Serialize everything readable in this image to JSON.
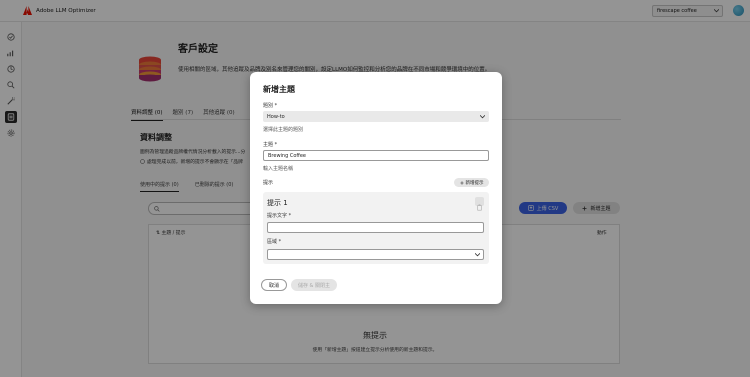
{
  "app": {
    "title": "Adobe LLM Optimizer",
    "brand_color": "#eb1000"
  },
  "org_selector": {
    "value": "firescape coffee"
  },
  "sidebar": {
    "icons": [
      "home-icon",
      "chart-icon",
      "compass-icon",
      "search-icon",
      "wand-icon",
      "settings-page-icon",
      "gear-icon"
    ],
    "active_index": 5
  },
  "page": {
    "title": "客戶設定",
    "description": "使用相關的區域，其他追蹤及品牌及別名來管理您的關別，設定LLMO如何監控和分析您的品牌在不同市場和競爭環境中的位置。"
  },
  "tabs": [
    "資料調整 (0)",
    "題別 (7)",
    "其他追蹤 (0)"
  ],
  "section": {
    "title": "資料調整",
    "description": "圖例為管理追蹤品牌權代情況分析載入的提示...分",
    "note": "處理完成以前，新增的提示不會顯示在「品牌"
  },
  "subtabs": [
    "使用中的提示 (0)",
    "已刪除的提示 (0)"
  ],
  "toolbar": {
    "upload_label": "上傳 CSV",
    "add_topic_label": "新增主題",
    "accent": "#3b63e6"
  },
  "table": {
    "col_topic": "主題 / 提示",
    "col_actions": "動作"
  },
  "empty": {
    "title": "無提示",
    "description": "使用「新增主題」按鈕建立提示分析使用的新主題和提示。"
  },
  "modal": {
    "title": "新增主題",
    "category_label": "題別 *",
    "category_value": "How-to",
    "category_help": "選擇此主題的題別",
    "topic_label": "主題 *",
    "topic_value": "Brewing Coffee",
    "topic_help": "輸入主題名稱",
    "prompts_label": "提示",
    "add_prompt_label": "新增提示",
    "prompt_card": {
      "title": "提示 1",
      "text_label": "提示文字 *",
      "region_label": "區域 *"
    },
    "cancel_label": "取消",
    "save_label": "儲存 & 關閉主"
  }
}
